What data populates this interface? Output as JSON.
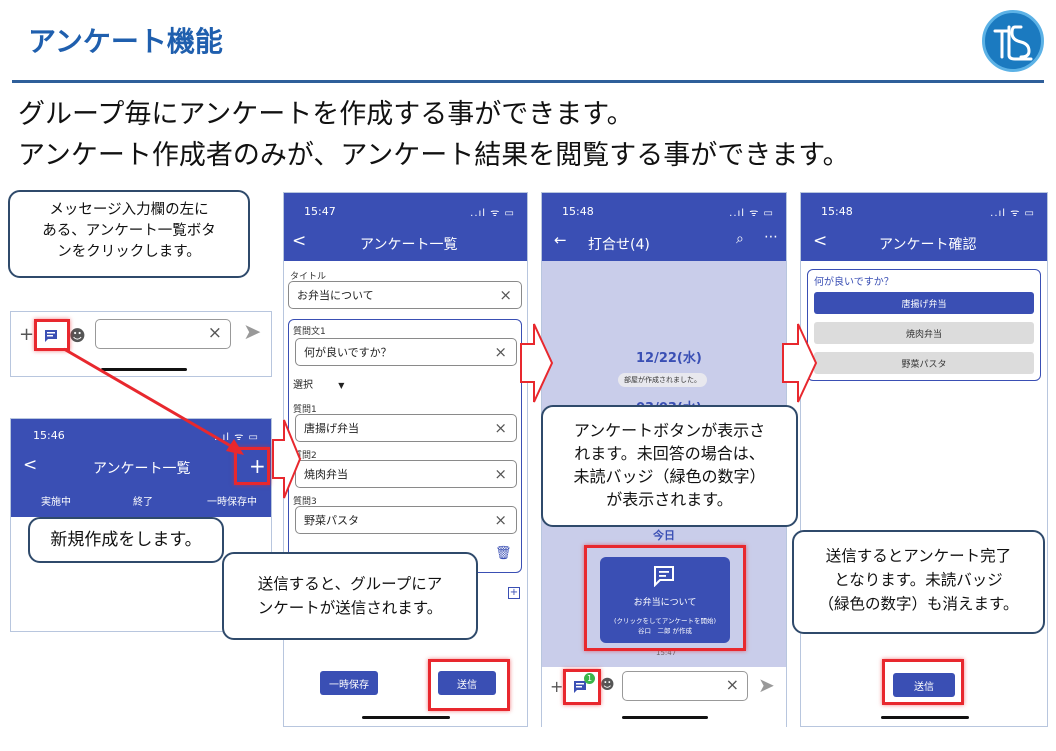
{
  "slide": {
    "title": "アンケート機能",
    "lead_line1": "グループ毎にアンケートを作成する事ができます。",
    "lead_line2": "アンケート作成者のみが、アンケート結果を閲覧する事ができます。"
  },
  "callouts": {
    "list_button": "メッセージ入力欄の左に\nある、アンケート一覧ボタ\nンをクリックします。",
    "new_create": "新規作成をします。",
    "send_group": "送信すると、グループにア\nンケートが送信されます。",
    "button_shown": "アンケートボタンが表示さ\nれます。未回答の場合は、\n未読バッジ（緑色の数字）\nが表示されます。",
    "send_complete": "送信するとアンケート完了\nとなります。未読バッジ\n（緑色の数字）も消えます。"
  },
  "input_bar": {
    "plus": "+",
    "clear": "×",
    "send": "➤"
  },
  "list_screen": {
    "time": "15:46",
    "signal": "..ıl ᯤ ▭",
    "title": "アンケート一覧",
    "add": "+",
    "tabs": [
      "実施中",
      "終了",
      "一時保存中"
    ]
  },
  "create_screen": {
    "time": "15:47",
    "signal": "..ıl ᯤ ▭",
    "title": "アンケート一覧",
    "title_label": "タイトル",
    "title_value": "お弁当について",
    "question_label": "質問文1",
    "question_value": "何が良いですか？",
    "select_label": "選択",
    "option_labels": [
      "質問1",
      "質問2",
      "質問3"
    ],
    "option_values": [
      "唐揚げ弁当",
      "焼肉弁当",
      "野菜パスタ"
    ],
    "save_temp": "一時保存",
    "send": "送信"
  },
  "chat_screen": {
    "time": "15:48",
    "signal": "..ıl ᯤ ▭",
    "title": "打合せ(4)",
    "date1": "12/22(水)",
    "room_created": "部屋が作成されました。",
    "date2": "03/03(水)",
    "today": "今日",
    "survey_title": "お弁当について",
    "survey_hint": "(クリックをしてアンケートを開始)",
    "survey_author": "谷口　二郎 が作成",
    "survey_time": "15:47",
    "badge": "1"
  },
  "confirm_screen": {
    "time": "15:48",
    "signal": "..ıl ᯤ ▭",
    "title": "アンケート確認",
    "question": "何が良いですか？",
    "options": [
      "唐揚げ弁当",
      "焼肉弁当",
      "野菜パスタ"
    ],
    "send": "送信"
  },
  "colors": {
    "primary": "#3a4fb4",
    "highlight": "#e8282e",
    "title": "#1f5fae"
  }
}
